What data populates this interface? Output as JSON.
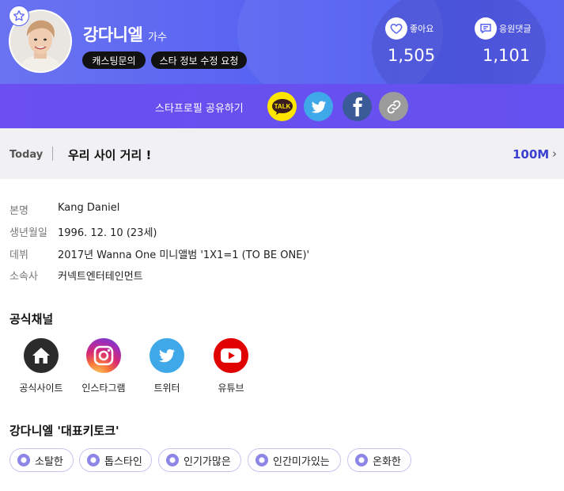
{
  "artist": {
    "name": "강다니엘",
    "role": "가수",
    "buttons": [
      "캐스팅문의",
      "스타 정보 수정 요청"
    ]
  },
  "stats": {
    "likes": {
      "label": "좋아요",
      "value": "1,505"
    },
    "comments": {
      "label": "응원댓글",
      "value": "1,101"
    }
  },
  "share": {
    "label": "스타프로필 공유하기",
    "icons": [
      "kakaotalk-icon",
      "twitter-icon",
      "facebook-icon",
      "link-icon"
    ],
    "kakao_text": "TALK"
  },
  "today": {
    "label": "Today",
    "text": "우리 사이 거리 !",
    "count": "100M",
    "chevron": "›"
  },
  "profile": [
    {
      "key": "본명",
      "value": "Kang Daniel"
    },
    {
      "key": "생년월일",
      "value": "1996. 12. 10 (23세)"
    },
    {
      "key": "데뷔",
      "value": "2017년 Wanna One 미니앨범 '1X1=1 (TO BE ONE)'"
    },
    {
      "key": "소속사",
      "value": "커넥트엔터테인먼트"
    }
  ],
  "channels": {
    "title": "공식채널",
    "items": [
      {
        "label": "공식사이트",
        "icon": "home-icon"
      },
      {
        "label": "인스타그램",
        "icon": "instagram-icon"
      },
      {
        "label": "트위터",
        "icon": "twitter-icon"
      },
      {
        "label": "유튜브",
        "icon": "youtube-icon"
      }
    ]
  },
  "keywords": {
    "title": "강다니엘 '대표키토크'",
    "items": [
      "소탈한",
      "톱스타인",
      "인기가많은",
      "인간미가있는",
      "온화한"
    ]
  },
  "colors": {
    "header": "#5a66f2",
    "share_bar": "#6a4ef0",
    "accent": "#3a3fd0",
    "kakao": "#fde500",
    "twitter": "#3fa8e8",
    "facebook": "#3b5a98",
    "youtube": "#e00000"
  }
}
